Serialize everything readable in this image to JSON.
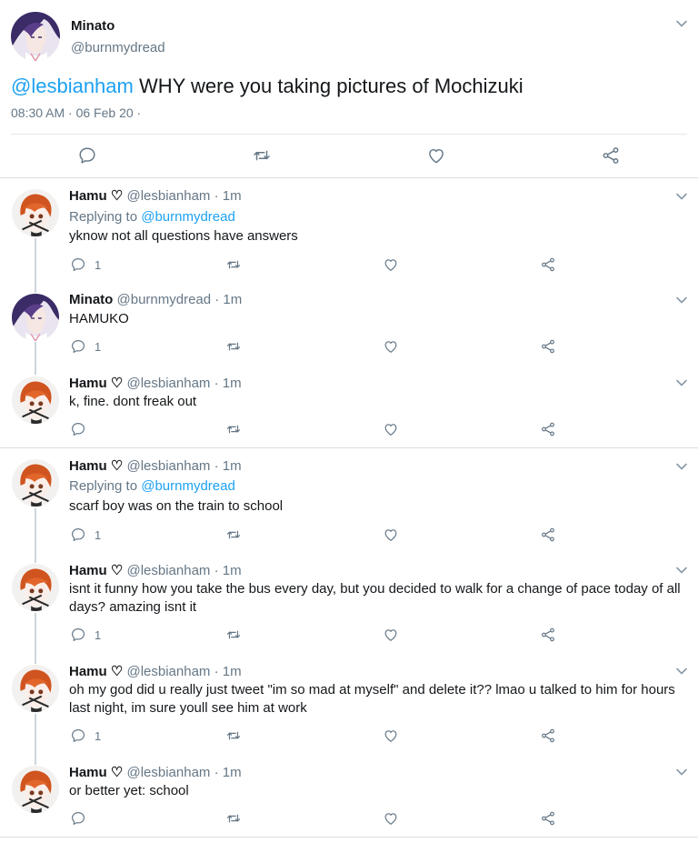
{
  "main_tweet": {
    "name": "Minato",
    "handle": "@burnmydread",
    "mention": "@lesbianham",
    "text": " WHY were you taking pictures of Mochizuki",
    "timestamp": "08:30 AM · 06 Feb 20 ·",
    "icons": {
      "reply": "reply-icon",
      "retweet": "retweet-icon",
      "like": "heart-icon",
      "share": "share-icon",
      "menu": "chevron-down-icon"
    }
  },
  "replies": [
    {
      "name": "Hamu ♡",
      "meta": " @lesbianham · 1m",
      "replying_prefix": "Replying to ",
      "replying_to": "@burnmydread",
      "text": "yknow not all questions have answers",
      "reply_count": "1",
      "avatar": "hamu"
    },
    {
      "name": "Minato",
      "meta": " @burnmydread · 1m",
      "text": "HAMUKO",
      "reply_count": "1",
      "avatar": "minato"
    },
    {
      "name": "Hamu ♡",
      "meta": " @lesbianham · 1m",
      "text": "k, fine. dont freak out",
      "reply_count": "",
      "avatar": "hamu"
    },
    {
      "name": "Hamu ♡",
      "meta": " @lesbianham · 1m",
      "replying_prefix": "Replying to ",
      "replying_to": "@burnmydread",
      "text": "scarf boy was on the train to school",
      "reply_count": "1",
      "avatar": "hamu"
    },
    {
      "name": "Hamu ♡",
      "meta": " @lesbianham · 1m",
      "text": "isnt it funny how you take the bus every day, but you decided to walk for a change of pace today of all days? amazing isnt it",
      "reply_count": "1",
      "avatar": "hamu"
    },
    {
      "name": "Hamu ♡",
      "meta": " @lesbianham · 1m",
      "text": "oh my god did u really just tweet \"im so mad at myself\" and delete it?? lmao u talked to him for hours last night, im sure youll see him at work",
      "reply_count": "1",
      "avatar": "hamu"
    },
    {
      "name": "Hamu ♡",
      "meta": " @lesbianham · 1m",
      "text": "or better yet: school",
      "reply_count": "",
      "avatar": "hamu"
    }
  ],
  "colors": {
    "accent": "#1da1f2",
    "secondary_text": "#657786",
    "divider": "#e1e8ed"
  }
}
